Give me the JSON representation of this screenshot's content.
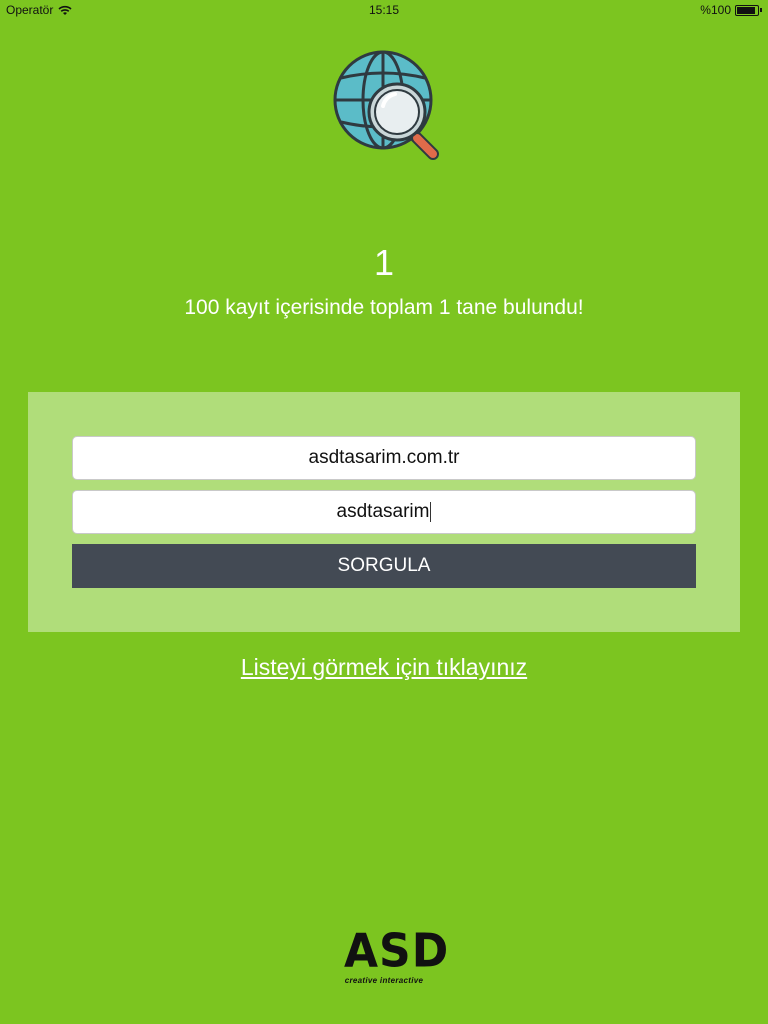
{
  "status_bar": {
    "carrier": "Operatör",
    "time": "15:15",
    "battery": "%100"
  },
  "result": {
    "count": "1",
    "message": "100 kayıt içerisinde toplam 1 tane bulundu!"
  },
  "form": {
    "domain_value": "asdtasarim.com.tr",
    "username_value": "asdtasarim",
    "button_label": "SORGULA"
  },
  "list_link": "Listeyi görmek için tıklayınız",
  "brand": {
    "logo": "ASD",
    "tagline": "creative interactive"
  },
  "colors": {
    "background": "#7cc520",
    "panel": "#b0dd7a",
    "button": "#434a54"
  }
}
